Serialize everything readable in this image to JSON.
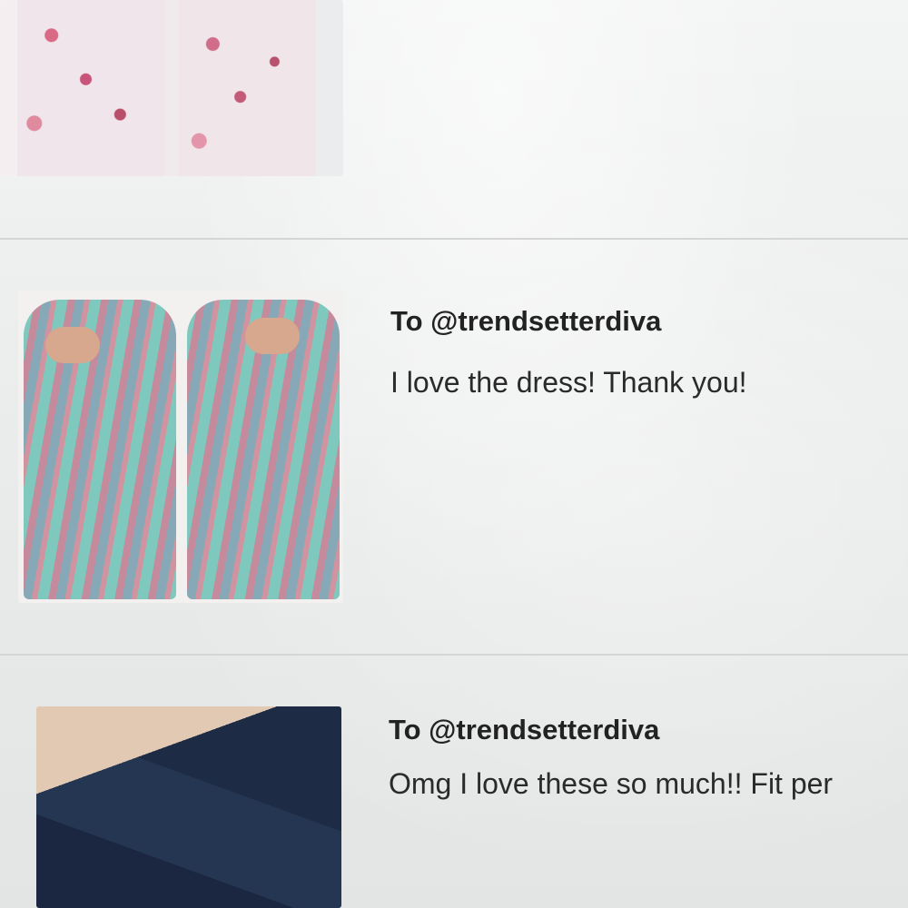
{
  "feed": {
    "items": [
      {
        "image_icon": "floral-dress-photo",
        "title": "",
        "message": ""
      },
      {
        "image_icon": "striped-cold-shoulder-dress-photo",
        "title": "To @trendsetterdiva",
        "message": "I love the dress! Thank you!"
      },
      {
        "image_icon": "jeans-photo",
        "title": "To @trendsetterdiva",
        "message": "Omg I love these so much!! Fit per"
      }
    ]
  },
  "colors": {
    "background": "#eceeef",
    "divider": "#d3d5d6",
    "title_text": "#222222",
    "message_text": "#2a2a2a"
  }
}
